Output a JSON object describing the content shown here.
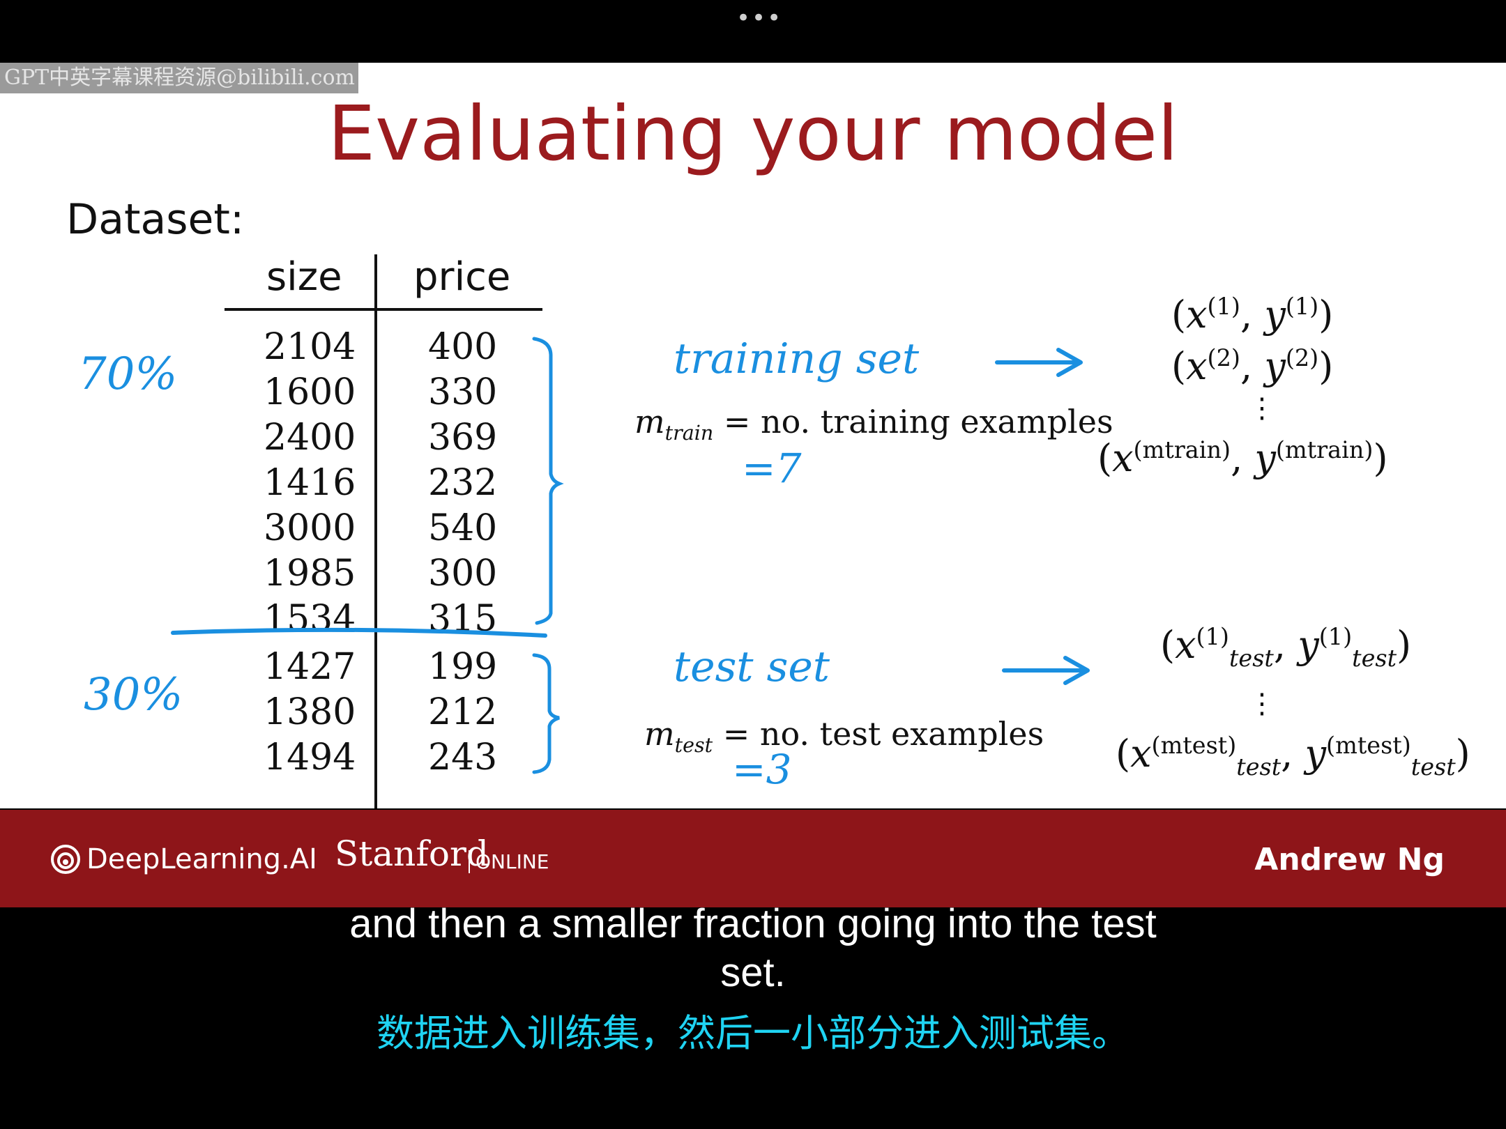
{
  "window": {
    "more_dots": "•••"
  },
  "watermark": "GPT中英字幕课程资源@bilibili.com",
  "slide": {
    "title": "Evaluating your model",
    "dataset_label": "Dataset:",
    "table": {
      "headers": [
        "size",
        "price"
      ],
      "rows": [
        [
          "2104",
          "400"
        ],
        [
          "1600",
          "330"
        ],
        [
          "2400",
          "369"
        ],
        [
          "1416",
          "232"
        ],
        [
          "3000",
          "540"
        ],
        [
          "1985",
          "300"
        ],
        [
          "1534",
          "315"
        ],
        [
          "1427",
          "199"
        ],
        [
          "1380",
          "212"
        ],
        [
          "1494",
          "243"
        ]
      ]
    },
    "split": {
      "train_pct": "70%",
      "test_pct": "30%"
    },
    "training": {
      "label": "training set",
      "m_symbol": "m",
      "m_sub": "train",
      "definition": "= no. training examples",
      "count": "=7",
      "pair1_sup": "(1)",
      "pair2_sup": "(2)",
      "pairN_sup": "(mtrain)"
    },
    "test": {
      "label": "test set",
      "m_symbol": "m",
      "m_sub": "test",
      "definition": "= no. test examples",
      "count": "=3",
      "pair1_sup": "(1)",
      "pairN_sup": "(mtest)",
      "sub": "test"
    },
    "colors": {
      "title": "#9b1b1e",
      "ink": "#1a8fe0",
      "footer": "#8e1519"
    }
  },
  "footer": {
    "logo_deeplearning": "DeepLearning.AI",
    "logo_stanford": "Stanford",
    "logo_online": "ONLINE",
    "author": "Andrew Ng"
  },
  "subtitles": {
    "en_line1": "and then a smaller fraction going into the test",
    "en_line2": "set.",
    "zh": "数据进入训练集，然后一小部分进入测试集。"
  }
}
